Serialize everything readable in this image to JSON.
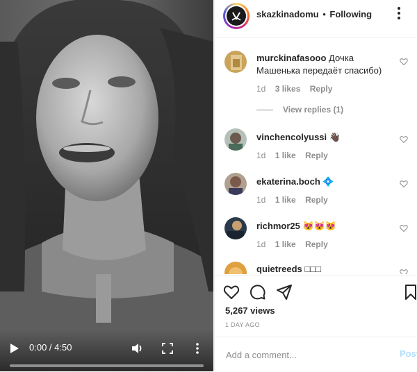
{
  "video": {
    "time": "0:00 / 4:50",
    "progress": 0.0,
    "icons": {
      "play": "play-icon",
      "volume": "volume-icon",
      "fullscreen": "fullscreen-icon",
      "more": "more-vertical-icon"
    }
  },
  "header": {
    "username": "skazkinadomu",
    "separator": "•",
    "follow_label": "Following"
  },
  "comments": [
    {
      "username": "murckinafasooo",
      "text": "Дочка Машенька передаёт спасибо)",
      "time": "1d",
      "likes": "3 likes",
      "reply": "Reply",
      "avatar_color": "#c9a45a"
    },
    {
      "username": "vinchencolyussi",
      "text": "👋🏿",
      "time": "1d",
      "likes": "1 like",
      "reply": "Reply",
      "avatar_color": "#9aa7a0"
    },
    {
      "username": "ekaterina.boch",
      "text": "💠",
      "time": "1d",
      "likes": "1 like",
      "reply": "Reply",
      "avatar_color": "#8a6a5a"
    },
    {
      "username": "richmor25",
      "text": "😻😻😻",
      "time": "1d",
      "likes": "1 like",
      "reply": "Reply",
      "avatar_color": "#2b3a4a"
    },
    {
      "username": "quietreeds",
      "text": "□□□",
      "time": "",
      "likes": "",
      "reply": "",
      "avatar_color": "#e0a040"
    }
  ],
  "view_replies": "View replies (1)",
  "post": {
    "views": "5,267 views",
    "ago": "1 DAY AGO"
  },
  "add_comment": {
    "placeholder": "Add a comment...",
    "post_label": "Post"
  },
  "colors": {
    "link_disabled": "#b2dffc",
    "muted": "#8e8e8e",
    "text": "#262626"
  }
}
